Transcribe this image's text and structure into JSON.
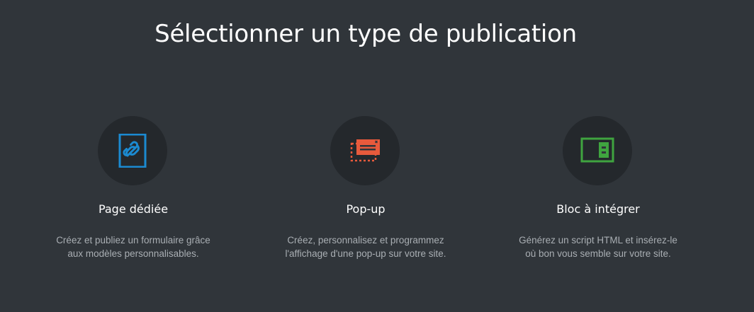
{
  "header": {
    "title": "Sélectionner un type de publication"
  },
  "options": [
    {
      "title": "Page dédiée",
      "description_line1": "Créez et publiez un formulaire grâce",
      "description_line2": "aux modèles personnalisables.",
      "icon": "link-page-icon",
      "color": "#1b8ad1"
    },
    {
      "title": "Pop-up",
      "description_line1": "Créez, personnalisez et programmez",
      "description_line2": "l'affichage d'une pop-up sur votre site.",
      "icon": "popup-window-icon",
      "color": "#e85a3c"
    },
    {
      "title": "Bloc à intégrer",
      "description_line1": "Générez un script HTML et insérez-le",
      "description_line2": "où bon vous semble sur votre site.",
      "icon": "embed-block-icon",
      "color": "#3fa43f"
    }
  ]
}
